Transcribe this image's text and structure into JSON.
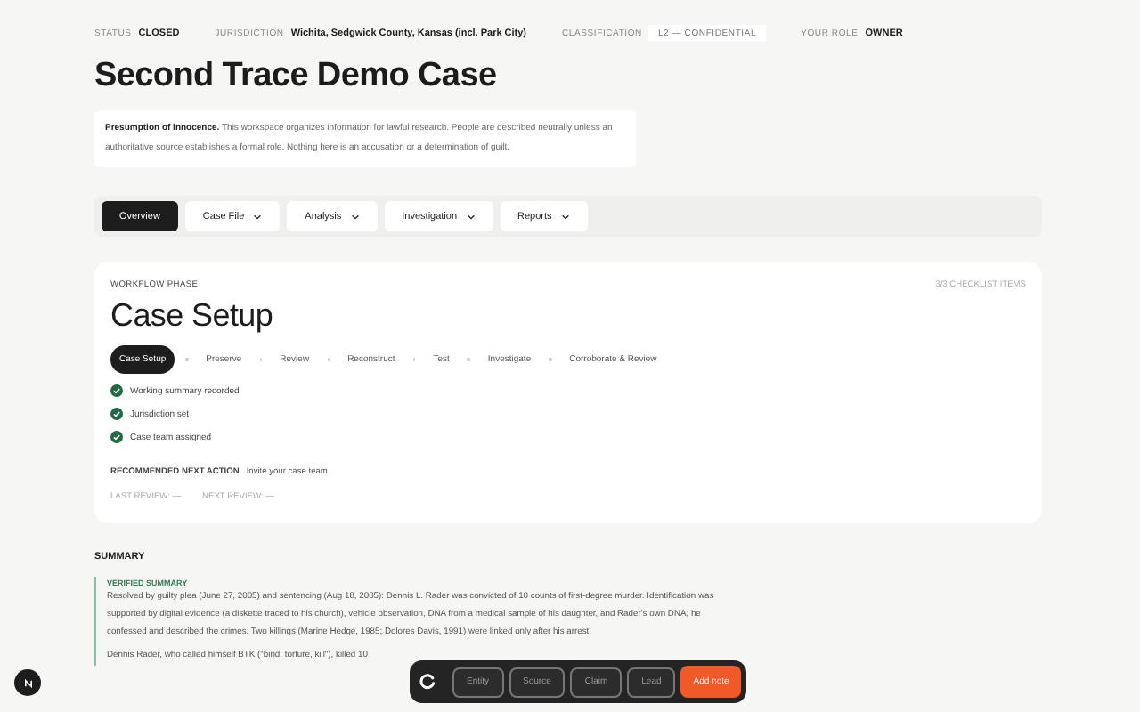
{
  "meta": [
    {
      "label": "STATUS",
      "value": "CLOSED",
      "kind": "plain"
    },
    {
      "label": "JURISDICTION",
      "value": "Wichita, Sedgwick County, Kansas (incl. Park City)",
      "kind": "plain"
    },
    {
      "label": "CLASSIFICATION",
      "value": "L2 — CONFIDENTIAL",
      "kind": "pill"
    },
    {
      "label": "YOUR ROLE",
      "value": "OWNER",
      "kind": "plain"
    }
  ],
  "title": "Second Trace Demo Case",
  "notice": "**Presumption of innocence.** This workspace organizes information for lawful research. People are described neutrally unless an authoritative source establishes a formal role. Nothing here is an accusation or a determination of guilt.",
  "nav": [
    {
      "label": "Overview",
      "selected": true,
      "menu": false
    },
    {
      "label": "Case File",
      "selected": false,
      "menu": true
    },
    {
      "label": "Analysis",
      "selected": false,
      "menu": true
    },
    {
      "label": "Investigation",
      "selected": false,
      "menu": true
    },
    {
      "label": "Reports",
      "selected": false,
      "menu": true
    }
  ],
  "phase": {
    "eyebrow": "WORKFLOW PHASE",
    "count": "3/3 CHECKLIST ITEMS",
    "title": "Case Setup",
    "steps": [
      {
        "label": "Case Setup",
        "selected": true
      },
      {
        "label": "Preserve",
        "selected": false
      },
      {
        "label": "Review",
        "selected": false
      },
      {
        "label": "Reconstruct",
        "selected": false
      },
      {
        "label": "Test",
        "selected": false
      },
      {
        "label": "Investigate",
        "selected": false
      },
      {
        "label": "Corroborate & Review",
        "selected": false
      }
    ],
    "checklist": [
      {
        "label": "Working summary recorded",
        "checked": true
      },
      {
        "label": "Jurisdiction set",
        "checked": true
      },
      {
        "label": "Case team assigned",
        "checked": true
      }
    ],
    "next_label": "RECOMMENDED NEXT ACTION",
    "next_value": "Invite your case team.",
    "last_review": "LAST REVIEW: —",
    "next_review": "NEXT REVIEW: —"
  },
  "summary": {
    "heading": "SUMMARY",
    "label": "VERIFIED SUMMARY",
    "paragraphs": [
      "Resolved by guilty plea (June 27, 2005) and sentencing (Aug 18, 2005): Dennis L. Rader was convicted of 10 counts of first-degree murder. Identification was supported by digital evidence (a diskette traced to his church), vehicle observation, DNA from a medical sample of his daughter, and Rader's own DNA; he confessed and described the crimes. Two killings (Marine Hedge, 1985; Dolores Davis, 1991) were linked only after his arrest.",
      "Dennis Rader, who called himself BTK (\"bind, torture, kill\"), killed 10"
    ]
  },
  "toolbar": [
    "Entity",
    "Source",
    "Claim",
    "Lead"
  ],
  "add_button": "Add note"
}
